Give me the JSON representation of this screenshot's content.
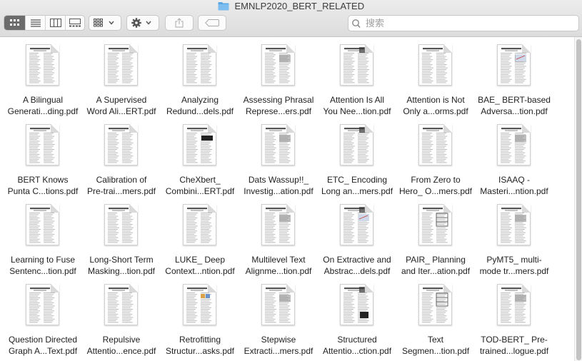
{
  "window": {
    "title": "EMNLP2020_BERT_RELATED"
  },
  "toolbar": {
    "view_modes": [
      {
        "name": "view-icons-button",
        "icon": "icon-grid-icon",
        "active": true
      },
      {
        "name": "view-list-button",
        "icon": "list-icon",
        "active": false
      },
      {
        "name": "view-columns-button",
        "icon": "columns-icon",
        "active": false
      },
      {
        "name": "view-gallery-button",
        "icon": "gallery-icon",
        "active": false
      }
    ],
    "group_icon": "group-grid-icon",
    "action_icon": "gear-icon",
    "share_icon": "share-icon",
    "tag_icon": "tag-icon"
  },
  "search": {
    "placeholder": "搜索",
    "value": ""
  },
  "files": [
    {
      "line1": "A Bilingual",
      "line2": "Generati...ding.pdf"
    },
    {
      "line1": "A Supervised",
      "line2": "Word Ali...ERT.pdf"
    },
    {
      "line1": "Analyzing",
      "line2": "Redund...dels.pdf"
    },
    {
      "line1": "Assessing Phrasal",
      "line2": "Represe...ers.pdf"
    },
    {
      "line1": "Attention Is All",
      "line2": "You Nee...tion.pdf"
    },
    {
      "line1": "Attention is Not",
      "line2": "Only a...orms.pdf"
    },
    {
      "line1": "BAE_ BERT-based",
      "line2": "Adversa...tion.pdf"
    },
    {
      "line1": "BERT Knows",
      "line2": "Punta C...tions.pdf"
    },
    {
      "line1": "Calibration of",
      "line2": "Pre-trai...mers.pdf"
    },
    {
      "line1": "CheXbert_",
      "line2": "Combini...ERT.pdf"
    },
    {
      "line1": "Dats Wassup!!_",
      "line2": "Investig...ation.pdf"
    },
    {
      "line1": "ETC_ Encoding",
      "line2": "Long an...mers.pdf"
    },
    {
      "line1": "From Zero to",
      "line2": "Hero_ O...mers.pdf"
    },
    {
      "line1": "ISAAQ -",
      "line2": "Masteri...ntion.pdf"
    },
    {
      "line1": "Learning to Fuse",
      "line2": "Sentenc...tion.pdf"
    },
    {
      "line1": "Long-Short Term",
      "line2": "Masking...tion.pdf"
    },
    {
      "line1": "LUKE_ Deep",
      "line2": "Context...ntion.pdf"
    },
    {
      "line1": "Multilevel Text",
      "line2": "Alignme...tion.pdf"
    },
    {
      "line1": "On Extractive and",
      "line2": "Abstrac...dels.pdf"
    },
    {
      "line1": "PAIR_ Planning",
      "line2": "and Iter...ation.pdf"
    },
    {
      "line1": "PyMT5_ multi-",
      "line2": "mode tr...mers.pdf"
    },
    {
      "line1": "Question Directed",
      "line2": "Graph A...Text.pdf"
    },
    {
      "line1": "Repulsive",
      "line2": "Attentio...ence.pdf"
    },
    {
      "line1": "Retrofitting",
      "line2": "Structur...asks.pdf"
    },
    {
      "line1": "Stepwise",
      "line2": "Extracti...mers.pdf"
    },
    {
      "line1": "Structured",
      "line2": "Attentio...ction.pdf"
    },
    {
      "line1": "Text",
      "line2": "Segmen...tion.pdf"
    },
    {
      "line1": "TOD-BERT_ Pre-",
      "line2": "trained...logue.pdf"
    }
  ],
  "colors": {
    "folder": "#5aa7e6",
    "active_view": "#6c6c6c"
  }
}
